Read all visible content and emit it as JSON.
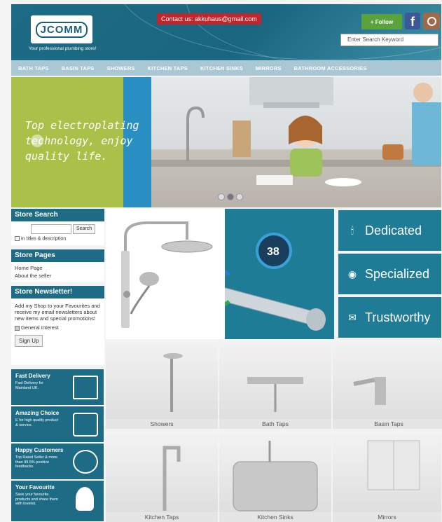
{
  "header": {
    "logo_text": "JCOMM",
    "tagline": "Your professional plumbing store!",
    "contact": "Contact us: akkuhaus@gmail.com",
    "follow_label": "+ Follow",
    "facebook_glyph": "f",
    "search_placeholder": "Enter Search Keyword"
  },
  "nav": {
    "items": [
      "BATH TAPS",
      "BASIN TAPS",
      "SHOWERS",
      "KITCHEN TAPS",
      "KITCHEN SINKS",
      "MIRRORS",
      "BATHROOM ACCESSORIES"
    ]
  },
  "banner": {
    "text": "Top electroplating technology, enjoy quality life."
  },
  "sidebar": {
    "store_search": {
      "title": "Store Search",
      "button": "Search",
      "checkbox_label": "in titles & description"
    },
    "store_pages": {
      "title": "Store Pages",
      "links": [
        "Home Page",
        "About the seller"
      ]
    },
    "newsletter": {
      "title": "Store Newsletter!",
      "text": "Add my Shop to your Favourites and receive my email newsletters about new items and special promotions!",
      "checkbox_label": "General Interest",
      "button": "Sign Up"
    }
  },
  "promos": [
    {
      "title": "Fast Delivery",
      "desc": "Fast Delivery for Mainland UK."
    },
    {
      "title": "Amazing Choice",
      "desc": "E for high quality product & service."
    },
    {
      "title": "Happy Customers",
      "desc": "Top Rated Seller & more than 99.5% positive feedbacks."
    },
    {
      "title": "Your Favourite",
      "desc": "Save your favourite products and share them with lovelist."
    }
  ],
  "features": {
    "temperature": "38",
    "tags": [
      {
        "label": "Dedicated",
        "icon": "tap-icon"
      },
      {
        "label": "Specialized",
        "icon": "target-icon"
      },
      {
        "label": "Trustworthy",
        "icon": "envelope-icon"
      }
    ]
  },
  "categories": [
    "Showers",
    "Bath Taps",
    "Basin Taps",
    "Kitchen Taps",
    "Kitchen Sinks",
    "Mirrors"
  ],
  "colors": {
    "primary": "#1d6b84",
    "feature_blue": "#1f7c97",
    "nav": "#a9c8d3",
    "banner_green": "#a9c149",
    "contact_red": "#c0262c",
    "follow_green": "#5aa23c"
  }
}
